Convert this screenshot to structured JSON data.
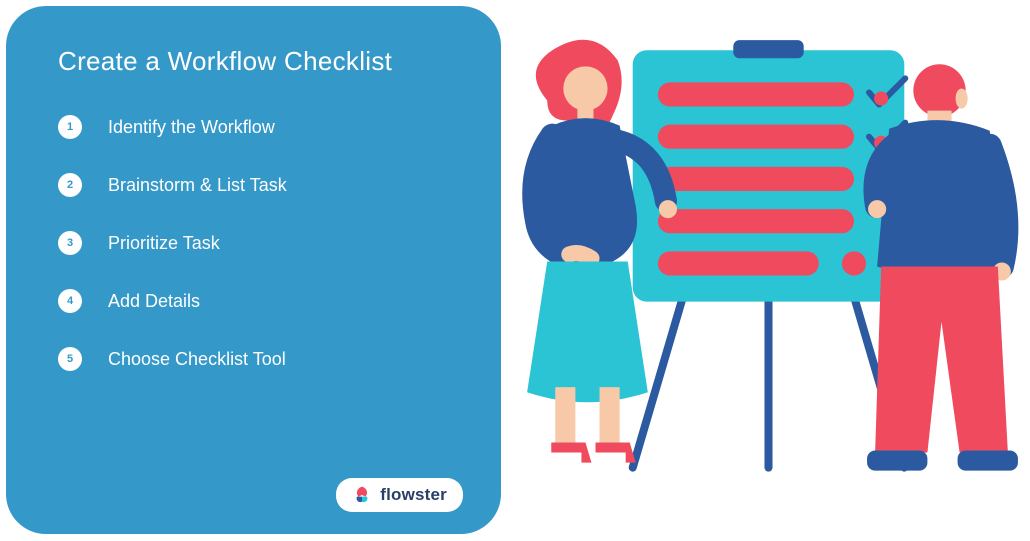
{
  "card": {
    "title": "Create a Workflow Checklist",
    "steps": [
      {
        "num": "1",
        "label": "Identify the Workflow"
      },
      {
        "num": "2",
        "label": "Brainstorm & List Task"
      },
      {
        "num": "3",
        "label": "Prioritize Task"
      },
      {
        "num": "4",
        "label": "Add Details"
      },
      {
        "num": "5",
        "label": "Choose Checklist Tool"
      }
    ],
    "brand": "flowster"
  },
  "illustration": {
    "name": "two-people-with-checklist-board",
    "board_rows": 5,
    "checks": 2
  },
  "colors": {
    "card_blue": "#3498c9",
    "accent": "#f04a5f",
    "teal": "#2bc4d4",
    "dark_blue": "#2b5aa0",
    "skin": "#f7c9a8"
  }
}
